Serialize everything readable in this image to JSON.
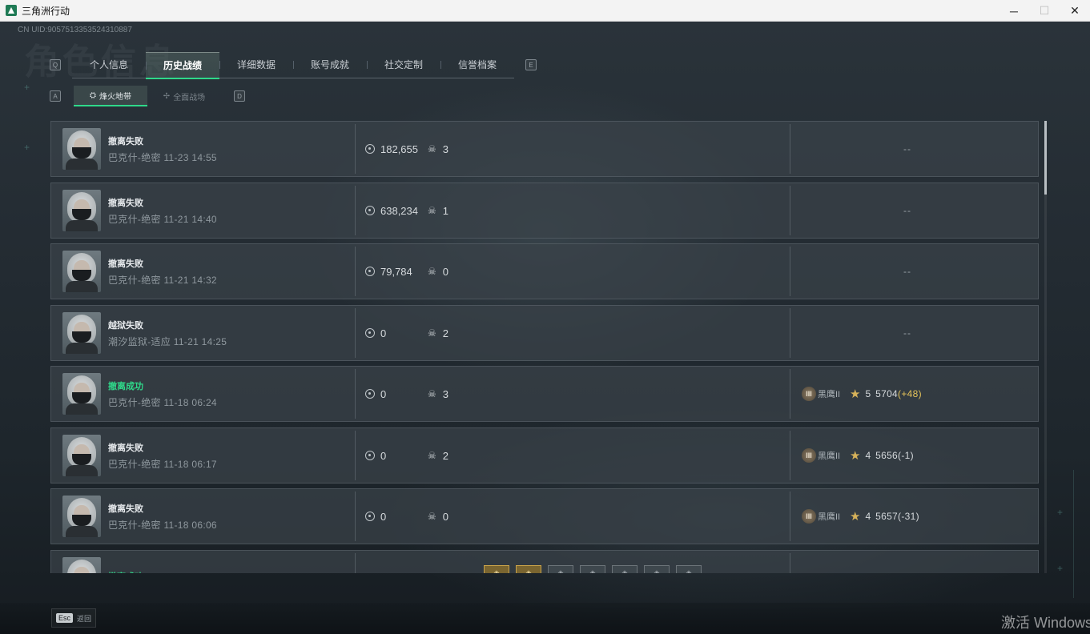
{
  "window": {
    "title": "三角洲行动",
    "controls": {
      "minimize": "─",
      "maximize": "☐",
      "close": "✕"
    }
  },
  "header": {
    "uid": "CN UID:9057513353524310887",
    "watermark": "角色信息"
  },
  "tabs": {
    "prev_key": "Q",
    "next_key": "E",
    "items": [
      {
        "label": "个人信息",
        "active": false
      },
      {
        "label": "历史战绩",
        "active": true
      },
      {
        "label": "详细数据",
        "active": false
      },
      {
        "label": "账号成就",
        "active": false
      },
      {
        "label": "社交定制",
        "active": false
      },
      {
        "label": "信誉档案",
        "active": false
      }
    ]
  },
  "subtabs": {
    "prev_key": "A",
    "next_key": "D",
    "items": [
      {
        "label": "烽火地带",
        "icon": "warzone-icon",
        "active": true
      },
      {
        "label": "全面战场",
        "icon": "battlefield-icon",
        "active": false
      }
    ]
  },
  "records": [
    {
      "status": "撤离失败",
      "success": false,
      "map": "巴克什-绝密",
      "time": "11-23 14:55",
      "value": "182,655",
      "kills": "3",
      "rank": null
    },
    {
      "status": "撤离失败",
      "success": false,
      "map": "巴克什-绝密",
      "time": "11-21 14:40",
      "value": "638,234",
      "kills": "1",
      "rank": null
    },
    {
      "status": "撤离失败",
      "success": false,
      "map": "巴克什-绝密",
      "time": "11-21 14:32",
      "value": "79,784",
      "kills": "0",
      "rank": null
    },
    {
      "status": "越狱失败",
      "success": false,
      "map": "潮汐监狱-适应",
      "time": "11-21 14:25",
      "value": "0",
      "kills": "2",
      "rank": null
    },
    {
      "status": "撤离成功",
      "success": true,
      "map": "巴克什-绝密",
      "time": "11-18 06:24",
      "value": "0",
      "kills": "3",
      "rank": {
        "tier_badge": "III",
        "tier_name": "黑鹰II",
        "stars": "5",
        "score": "5704",
        "delta": "(+48)",
        "delta_positive": true
      }
    },
    {
      "status": "撤离失败",
      "success": false,
      "map": "巴克什-绝密",
      "time": "11-18 06:17",
      "value": "0",
      "kills": "2",
      "rank": {
        "tier_badge": "III",
        "tier_name": "黑鹰II",
        "stars": "4",
        "score": "5656",
        "delta": "(-1)",
        "delta_positive": false
      }
    },
    {
      "status": "撤离失败",
      "success": false,
      "map": "巴克什-绝密",
      "time": "11-18 06:06",
      "value": "0",
      "kills": "0",
      "rank": {
        "tier_badge": "III",
        "tier_name": "黑鹰II",
        "stars": "4",
        "score": "5657",
        "delta": "(-31)",
        "delta_positive": false
      }
    },
    {
      "status": "撤离成功",
      "success": true,
      "map": "",
      "time": "",
      "value": "",
      "kills": "",
      "rank": null,
      "partial": true
    }
  ],
  "empty_rank": "--",
  "footer": {
    "esc_key": "Esc",
    "esc_label": "返回",
    "activate_text": "激活 Windows"
  },
  "colors": {
    "accent": "#2fd98a",
    "success": "#2fd98a",
    "positive_delta": "#e3c25a",
    "row_bg": "#3a4249"
  }
}
